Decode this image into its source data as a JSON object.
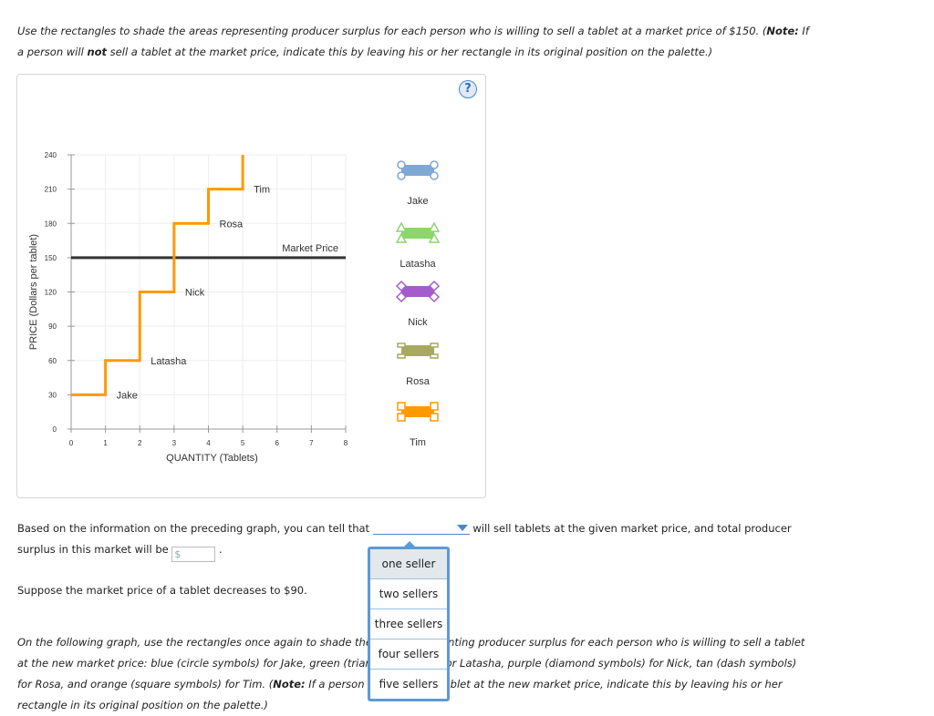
{
  "instructions": {
    "line1": "Use the rectangles to shade the areas representing producer surplus for each person who is willing to sell a tablet at a market price of $150. (",
    "note_label": "Note:",
    "line1_end": " If",
    "line2_a": "a person will ",
    "not": "not",
    "line2_b": " sell a tablet at the market price, indicate this by leaving his or her rectangle in its original position on the palette.)"
  },
  "help_icon": "?",
  "chart_data": {
    "type": "line",
    "xlabel": "QUANTITY (Tablets)",
    "ylabel": "PRICE (Dollars per tablet)",
    "xlim": [
      0,
      8
    ],
    "ylim": [
      0,
      240
    ],
    "x_ticks": [
      "0",
      "1",
      "2",
      "3",
      "4",
      "5",
      "6",
      "7",
      "8"
    ],
    "y_ticks": [
      "0",
      "30",
      "60",
      "90",
      "120",
      "150",
      "180",
      "210",
      "240"
    ],
    "grid": true,
    "supply_steps": [
      {
        "name": "Jake",
        "price": 30
      },
      {
        "name": "Latasha",
        "price": 60
      },
      {
        "name": "Nick",
        "price": 120
      },
      {
        "name": "Rosa",
        "price": 180
      },
      {
        "name": "Tim",
        "price": 210
      }
    ],
    "supply_color": "#ff9900",
    "market_price": {
      "label": "Market Price",
      "value": 150,
      "color": "#333333"
    }
  },
  "palette": [
    {
      "name": "Jake",
      "color": "#7fa8d4",
      "symbol": "circle"
    },
    {
      "name": "Latasha",
      "color": "#8cd66c",
      "symbol": "triangle"
    },
    {
      "name": "Nick",
      "color": "#a45ccc",
      "symbol": "diamond"
    },
    {
      "name": "Rosa",
      "color": "#a9a860",
      "symbol": "dash"
    },
    {
      "name": "Tim",
      "color": "#ff9900",
      "symbol": "square"
    }
  ],
  "question1": {
    "before": "Based on the information on the preceding graph, you can tell that",
    "after": "will sell tablets at the given market price, and total producer",
    "line2": "surplus in this market will be",
    "dollar_placeholder": "$",
    "end": "."
  },
  "dropdown_options": [
    "one seller",
    "two sellers",
    "three sellers",
    "four sellers",
    "five sellers"
  ],
  "question2": "Suppose the market price of a tablet decreases to $90.",
  "final": {
    "l1": "On the following graph, use the rectangles once again to shade the areas representing producer surplus for each person who is willing to sell a tablet",
    "l2": "at the new market price: blue (circle symbols) for Jake, green (triangle symbols) for Latasha, purple (diamond symbols) for Nick, tan (dash symbols)",
    "l3a": "for Rosa, and orange (square symbols) for Tim. (",
    "note_label": "Note:",
    "l3b": " If a person will not sell a tablet at the new market price, indicate this by leaving his or her",
    "l4": "rectangle in its original position on the palette.)"
  }
}
